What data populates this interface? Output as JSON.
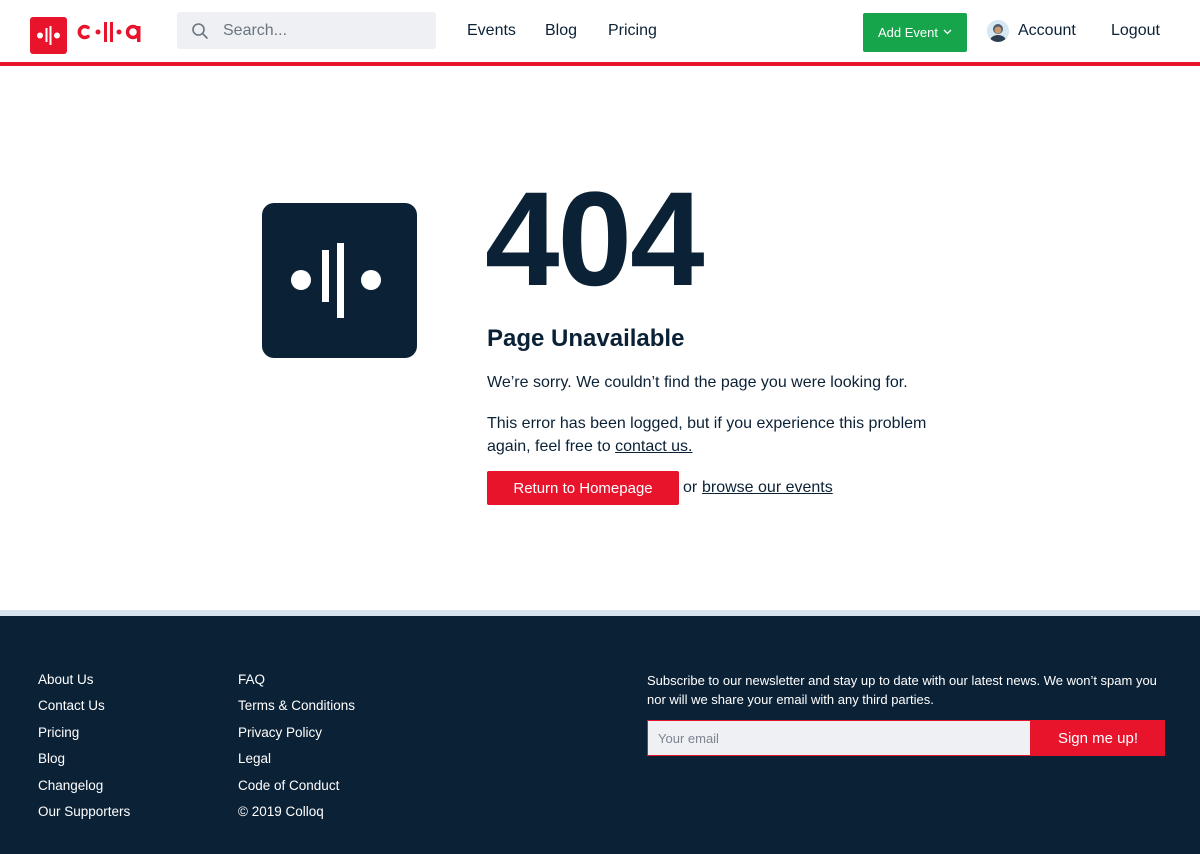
{
  "brand": {
    "name": "colloq",
    "accent": "#e8142c",
    "navy": "#0b2136",
    "green": "#17a54c"
  },
  "header": {
    "search_placeholder": "Search...",
    "nav": {
      "events": "Events",
      "blog": "Blog",
      "pricing": "Pricing"
    },
    "add_event": "Add Event",
    "account": "Account",
    "logout": "Logout"
  },
  "error": {
    "code": "404",
    "title": "Page Unavailable",
    "message": "We’re sorry. We couldn’t find the page you were looking for.",
    "logged_text": "This error has been logged, but if you experience this problem again, feel free to",
    "contact_link": "contact us.",
    "return_button": "Return to Homepage",
    "or_text": "or",
    "browse_link": "browse our events"
  },
  "footer": {
    "col1": [
      "About Us",
      "Contact Us",
      "Pricing",
      "Blog",
      "Changelog",
      "Our Supporters"
    ],
    "col2": [
      "FAQ",
      "Terms & Conditions",
      "Privacy Policy",
      "Legal",
      "Code of Conduct",
      "© 2019 Colloq"
    ],
    "newsletter_text": "Subscribe to our newsletter and stay up to date with our latest news. We won’t spam you nor will we share your email with any third parties.",
    "email_placeholder": "Your email",
    "signup_button": "Sign me up!"
  },
  "icons": [
    "colloq-logo-icon",
    "search-icon",
    "chevron-down-icon",
    "avatar-icon"
  ]
}
